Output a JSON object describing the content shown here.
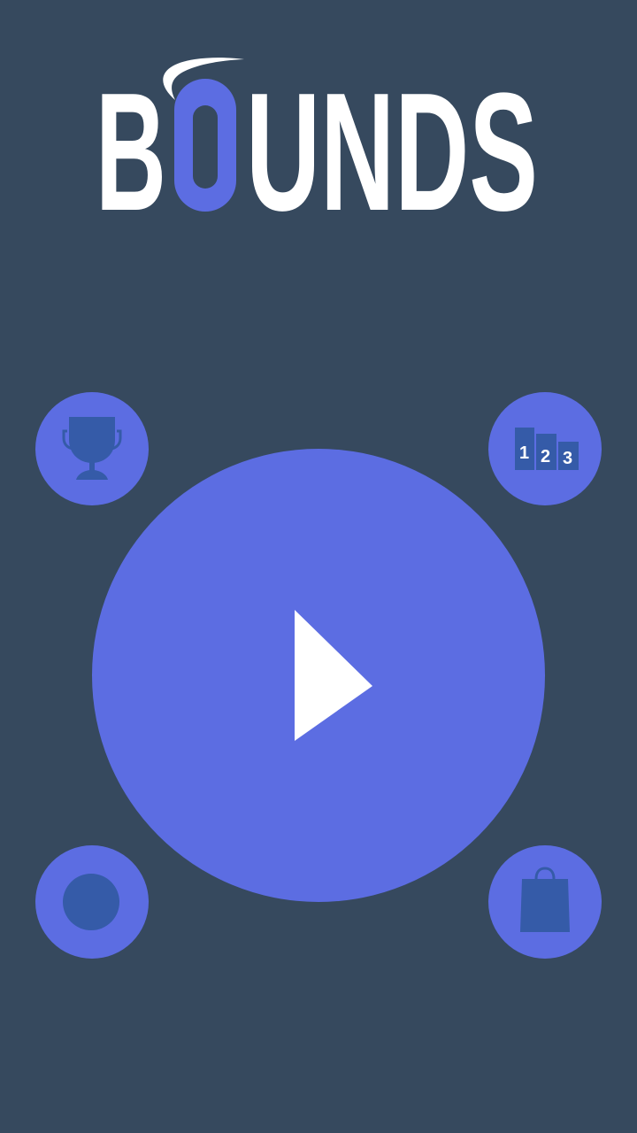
{
  "logo": {
    "text_before": "B",
    "text_accent": "O",
    "text_after": "UNDS"
  },
  "colors": {
    "background": "#36495e",
    "accent": "#5c6de2",
    "icon_dark": "#355ba8",
    "white": "#ffffff"
  },
  "buttons": {
    "play": {
      "icon": "play-icon"
    },
    "achievements": {
      "icon": "trophy-icon"
    },
    "leaderboard": {
      "icon": "podium-icon",
      "ranks": [
        "1",
        "2",
        "3"
      ]
    },
    "skins": {
      "icon": "ball-icon"
    },
    "shop": {
      "icon": "shopping-bag-icon"
    }
  }
}
